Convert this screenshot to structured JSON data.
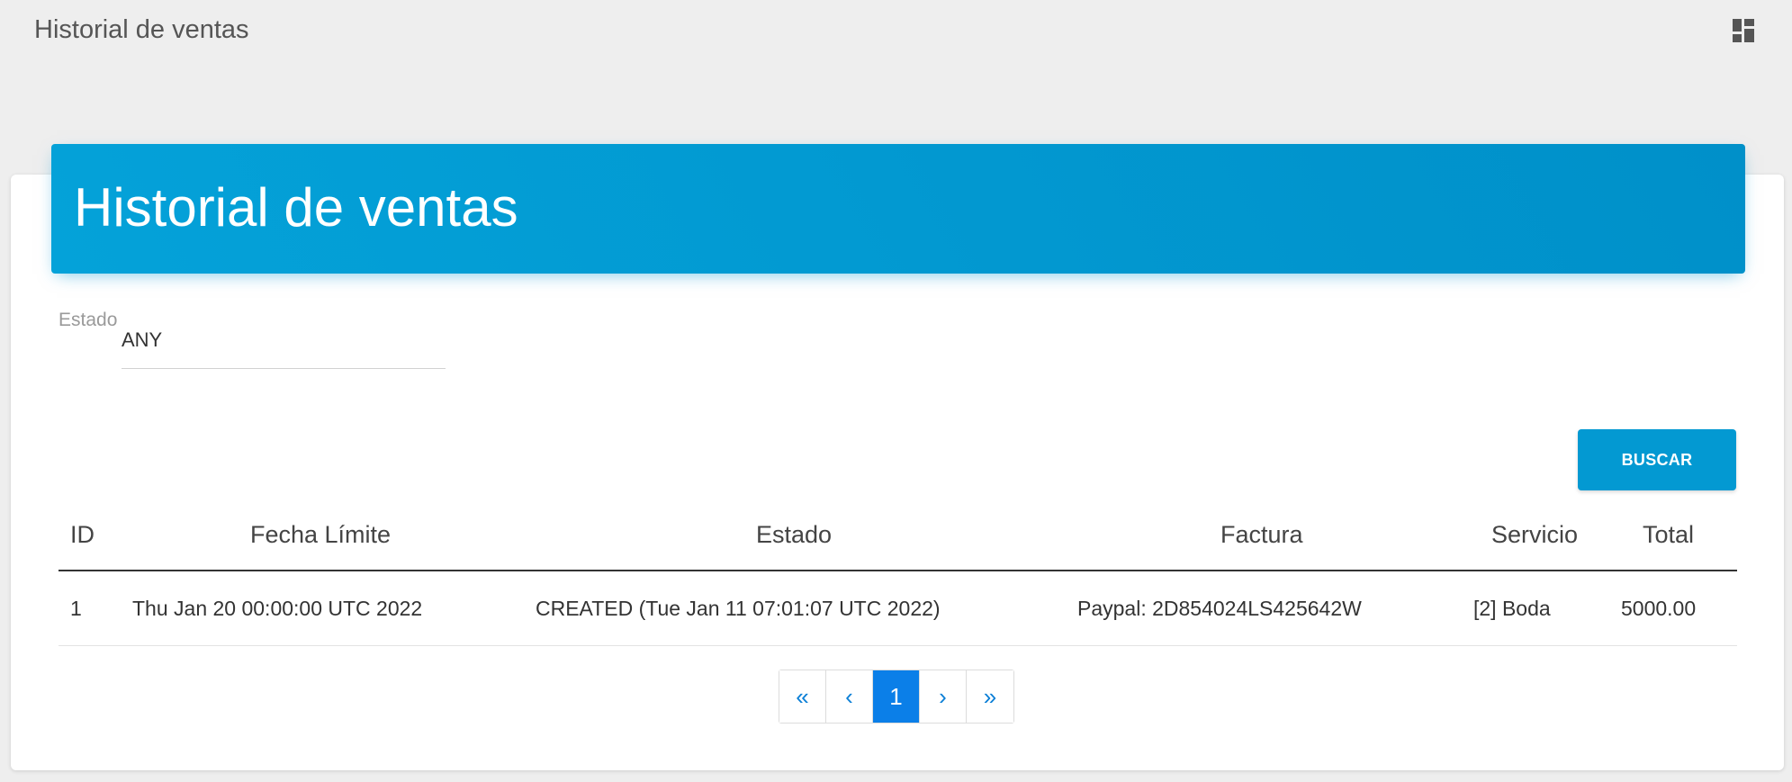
{
  "topbar": {
    "title": "Historial de ventas",
    "icon": "dashboard-icon"
  },
  "card": {
    "header_title": "Historial de ventas"
  },
  "filter": {
    "label": "Estado",
    "value": "ANY"
  },
  "search_button": "BUSCAR",
  "table": {
    "headers": [
      "ID",
      "Fecha Límite",
      "Estado",
      "Factura",
      "Servicio",
      "Total"
    ],
    "rows": [
      {
        "id": "1",
        "fecha": "Thu Jan 20 00:00:00 UTC 2022",
        "estado": "CREATED (Tue Jan 11 07:01:07 UTC 2022)",
        "factura": "Paypal: 2D854024LS425642W",
        "servicio": "[2] Boda",
        "total": "5000.00"
      }
    ]
  },
  "pagination": {
    "first": "«",
    "prev": "‹",
    "current": "1",
    "next": "›",
    "last": "»"
  },
  "colors": {
    "header_blue": "#0399d2",
    "page_active": "#0b7fe8"
  }
}
